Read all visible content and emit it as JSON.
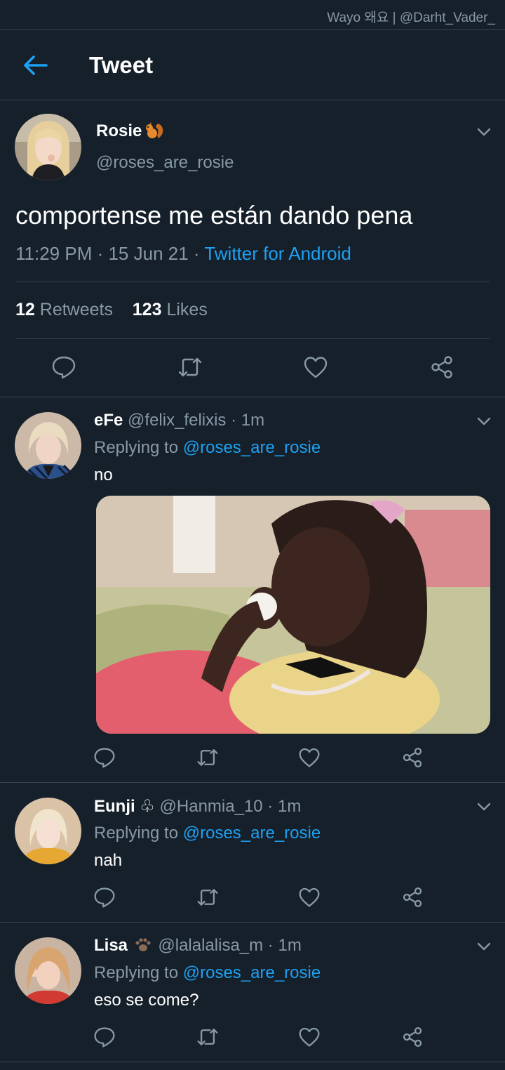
{
  "watermark": "Wayo 왜요 | @Darht_Vader_",
  "appbar": {
    "title": "Tweet"
  },
  "main_tweet": {
    "name": "Rosie",
    "handle": "@roses_are_rosie",
    "text": "comportense me están dando pena",
    "time": "11:29 PM",
    "date": "15 Jun 21",
    "source": "Twitter for Android",
    "retweets_count": "12",
    "retweets_label": "Retweets",
    "likes_count": "123",
    "likes_label": "Likes"
  },
  "replies": [
    {
      "name": "eFe",
      "handle": "@felix_felixis",
      "time": "1m",
      "replying_label": "Replying to",
      "replying_to": "@roses_are_rosie",
      "text": "no",
      "has_media": true
    },
    {
      "name": "Eunji ♧",
      "handle": "@Hanmia_10",
      "time": "1m",
      "replying_label": "Replying to",
      "replying_to": "@roses_are_rosie",
      "text": "nah"
    },
    {
      "name": "Lisa",
      "handle": "@lalalalisa_m",
      "time": "1m",
      "replying_label": "Replying to",
      "replying_to": "@roses_are_rosie",
      "text": "eso se come?"
    }
  ],
  "colors": {
    "background": "#15202b",
    "separator": "#38444d",
    "secondary_text": "#8899a6",
    "accent": "#1da1f2"
  },
  "icons": [
    "back-arrow-icon",
    "chevron-down-icon",
    "reply-icon",
    "retweet-icon",
    "like-icon",
    "share-icon",
    "squirrel-emoji-icon",
    "paw-emoji-icon"
  ]
}
